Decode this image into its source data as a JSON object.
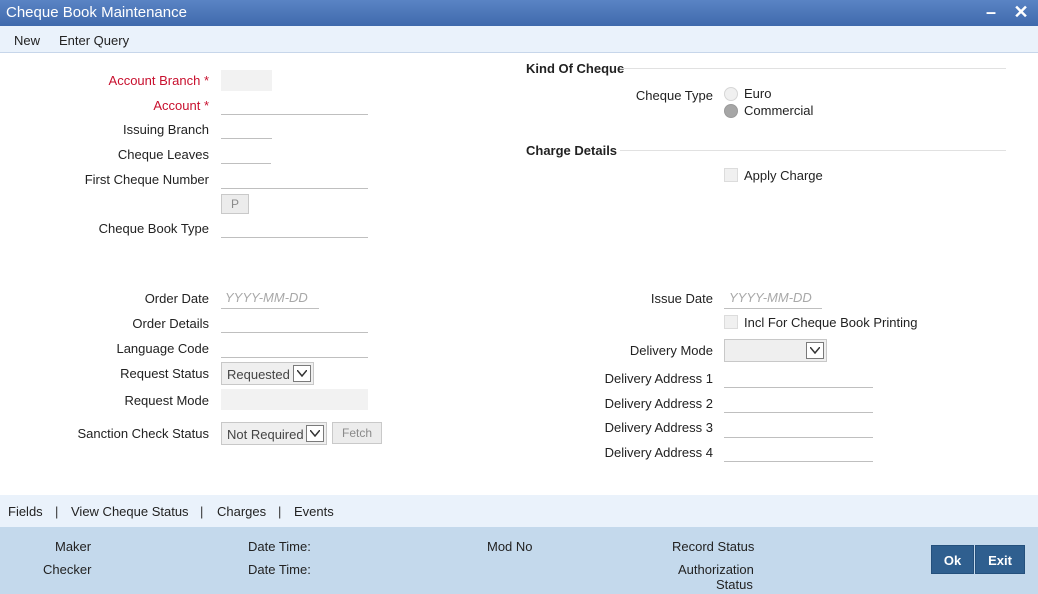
{
  "window": {
    "title": "Cheque Book Maintenance",
    "minimize_glyph": "–",
    "close_glyph": "✕"
  },
  "menu": {
    "new_label": "New",
    "enter_query_label": "Enter Query"
  },
  "left_form": {
    "account_branch_label": "Account Branch",
    "account_label": "Account",
    "required_marker": "*",
    "issuing_branch_label": "Issuing Branch",
    "cheque_leaves_label": "Cheque Leaves",
    "first_cheque_number_label": "First Cheque Number",
    "p_button_label": "P",
    "cheque_book_type_label": "Cheque Book Type"
  },
  "kind_of_cheque": {
    "section_title": "Kind Of Cheque",
    "cheque_type_label": "Cheque Type",
    "options": [
      "Euro",
      "Commercial"
    ],
    "selected": "Commercial"
  },
  "charge_details": {
    "section_title": "Charge Details",
    "apply_charge_label": "Apply Charge"
  },
  "order_section": {
    "order_date_label": "Order Date",
    "order_date_placeholder": "YYYY-MM-DD",
    "order_details_label": "Order Details",
    "language_code_label": "Language Code",
    "request_status_label": "Request Status",
    "request_status_value": "Requested",
    "request_mode_label": "Request Mode",
    "sanction_check_status_label": "Sanction Check Status",
    "sanction_check_status_value": "Not Required",
    "fetch_button_label": "Fetch"
  },
  "issue_section": {
    "issue_date_label": "Issue Date",
    "issue_date_placeholder": "YYYY-MM-DD",
    "incl_printing_label": "Incl For Cheque Book Printing",
    "delivery_mode_label": "Delivery Mode",
    "delivery_mode_value": "",
    "delivery_address_1_label": "Delivery Address 1",
    "delivery_address_2_label": "Delivery Address 2",
    "delivery_address_3_label": "Delivery Address 3",
    "delivery_address_4_label": "Delivery Address 4"
  },
  "tabs": {
    "fields": "Fields",
    "view_cheque_status": "View Cheque Status",
    "charges": "Charges",
    "events": "Events",
    "separator": "|"
  },
  "footer": {
    "maker_label": "Maker",
    "checker_label": "Checker",
    "date_time_label": "Date Time:",
    "mod_no_label": "Mod No",
    "record_status_label": "Record Status",
    "authorization_label": "Authorization",
    "status_label": "Status",
    "ok_label": "Ok",
    "exit_label": "Exit"
  },
  "colors": {
    "title_bar": "#4a76b8",
    "required": "#c8102e",
    "footer": "#c4d9ec",
    "button": "#2f5f8f"
  }
}
